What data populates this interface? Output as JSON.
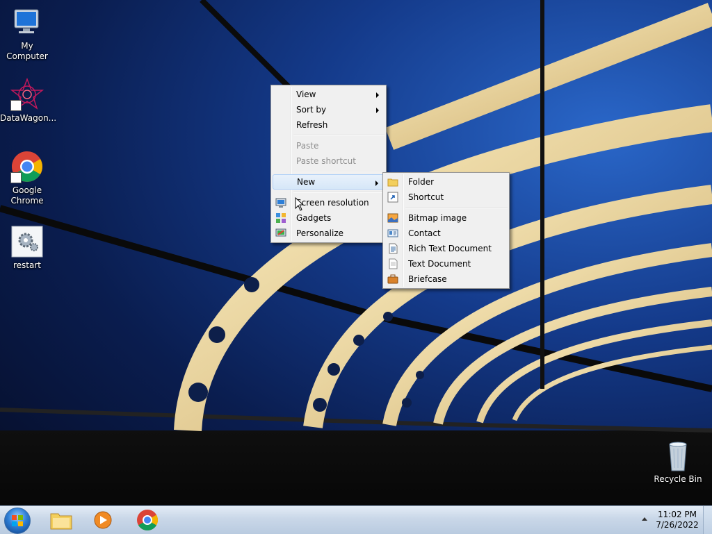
{
  "desktop_icons": [
    {
      "label": "My Computer",
      "icon": "computer-icon"
    },
    {
      "label": "DataWagon...",
      "icon": "datawagon-icon"
    },
    {
      "label": "Google Chrome",
      "icon": "chrome-icon"
    },
    {
      "label": "restart",
      "icon": "gear-icon"
    },
    {
      "label": "Recycle Bin",
      "icon": "recycle-bin-icon"
    }
  ],
  "context_menu": {
    "view": "View",
    "sort_by": "Sort by",
    "refresh": "Refresh",
    "paste": "Paste",
    "paste_shortcut": "Paste shortcut",
    "new": "New",
    "screen_resolution": "Screen resolution",
    "gadgets": "Gadgets",
    "personalize": "Personalize"
  },
  "new_submenu": {
    "folder": "Folder",
    "shortcut": "Shortcut",
    "bitmap_image": "Bitmap image",
    "contact": "Contact",
    "rich_text_document": "Rich Text Document",
    "text_document": "Text Document",
    "briefcase": "Briefcase"
  },
  "taskbar": {
    "pinned": [
      "file-explorer-icon",
      "media-player-icon",
      "chrome-icon"
    ],
    "clock_time": "11:02 PM",
    "clock_date": "7/26/2022"
  },
  "colors": {
    "menu_bg": "#f0f0f0",
    "menu_highlight": "#d6e7f8",
    "disabled_text": "#8f8f8f"
  }
}
